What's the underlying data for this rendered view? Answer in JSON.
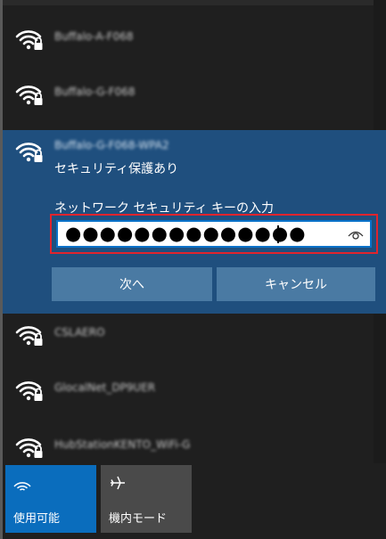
{
  "networks_above": [
    {
      "name": "Buffalo-A-F068"
    },
    {
      "name": "Buffalo-G-F068"
    }
  ],
  "selected_network": {
    "name": "Buffalo-G-F068-WPA2",
    "security": "セキュリティ保護あり",
    "key_label": "ネットワーク セキュリティ キーの入力",
    "password_value": "●●●●●●●●●●●●●●",
    "next_label": "次へ",
    "cancel_label": "キャンセル"
  },
  "networks_below": [
    {
      "name": "CSLAERO"
    },
    {
      "name": "GlocalNet_DP9UER"
    },
    {
      "name": "HubStationKENTO_WiFi-G"
    }
  ],
  "quick_actions": [
    {
      "label": "使用可能",
      "icon": "wifi-icon",
      "active": true
    },
    {
      "label": "機内モード",
      "icon": "airplane-icon",
      "active": false
    }
  ],
  "colors": {
    "panel_bg": "#1f1f1f",
    "selected_bg": "#1f4f7e",
    "button_bg": "#4a7aa3",
    "accent": "#0a6dbd",
    "highlight_border": "#e0242d"
  }
}
